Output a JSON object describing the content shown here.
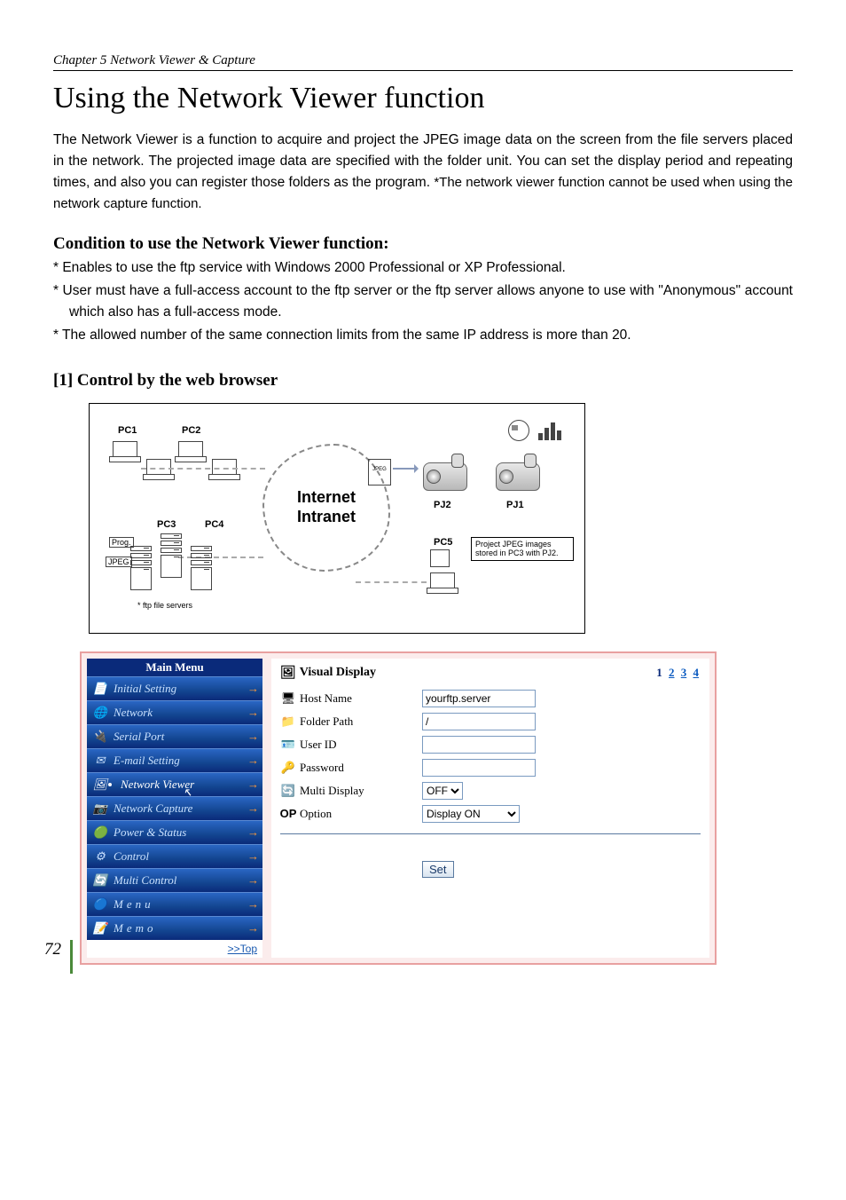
{
  "page_number": "72",
  "chapter": "Chapter 5 Network Viewer & Capture",
  "title": "Using the Network Viewer function",
  "intro_main": "The Network Viewer is a function to acquire and project the JPEG image data on the screen from the file servers placed in the network. The projected image data are specified with the folder unit. You can set the display period and repeating times, and also you can register those folders as the program. ",
  "intro_note": "*The network viewer function cannot be used when using the network capture function.",
  "condition_heading": "Condition to use the Network Viewer function:",
  "conditions": [
    "* Enables to use the ftp service with Windows 2000 Professional or XP Professional.",
    "* User must have a full-access account to the ftp server or the ftp server allows anyone to use with \"Anonymous\" account which also has a full-access mode.",
    "* The allowed number of the same connection limits from the same IP address is more than 20."
  ],
  "section_heading": "[1] Control by the web browser",
  "diagram": {
    "pc1": "PC1",
    "pc2": "PC2",
    "pc3": "PC3",
    "pc4": "PC4",
    "pc5": "PC5",
    "pj1": "PJ1",
    "pj2": "PJ2",
    "cloud_line1": "Internet",
    "cloud_line2": "Intranet",
    "servers_caption": "* ftp file servers",
    "jpeg": "JPEG",
    "noteboxA": "Project JPEG images stored in PC3 with PJ2.",
    "prog": "Prog.",
    "jpeg_tag": "JPEG"
  },
  "sidebar": {
    "title": "Main Menu",
    "items": [
      {
        "label": "Initial Setting",
        "icon": "📄",
        "name": "sidebar-item-initial-setting"
      },
      {
        "label": "Network",
        "icon": "🌐",
        "name": "sidebar-item-network"
      },
      {
        "label": "Serial Port",
        "icon": "🔌",
        "name": "sidebar-item-serial-port"
      },
      {
        "label": "E-mail Setting",
        "icon": "✉",
        "name": "sidebar-item-email-setting"
      },
      {
        "label": "Network Viewer",
        "icon": "🖼",
        "name": "sidebar-item-network-viewer",
        "selected": true
      },
      {
        "label": "Network Capture",
        "icon": "📷",
        "name": "sidebar-item-network-capture"
      },
      {
        "label": "Power & Status",
        "icon": "🟢",
        "name": "sidebar-item-power-status"
      },
      {
        "label": "Control",
        "icon": "⚙",
        "name": "sidebar-item-control"
      },
      {
        "label": "Multi Control",
        "icon": "🔄",
        "name": "sidebar-item-multi-control"
      },
      {
        "label": "Menu",
        "icon": "🔵",
        "name": "sidebar-item-menu",
        "spaced": true
      },
      {
        "label": "Memo",
        "icon": "📝",
        "name": "sidebar-item-memo",
        "spaced": true
      }
    ],
    "top_link": ">>Top"
  },
  "content": {
    "heading": "Visual Display",
    "pages_current": "1",
    "pages_links": [
      "2",
      "3",
      "4"
    ],
    "fields": {
      "host_name": {
        "label": "Host Name",
        "value": "yourftp.server"
      },
      "folder_path": {
        "label": "Folder Path",
        "value": "/"
      },
      "user_id": {
        "label": "User ID",
        "value": ""
      },
      "password": {
        "label": "Password",
        "value": ""
      },
      "multi_display": {
        "label": "Multi Display",
        "value": "OFF"
      },
      "option": {
        "label": "Option",
        "value": "Display ON"
      }
    },
    "set_button": "Set"
  }
}
